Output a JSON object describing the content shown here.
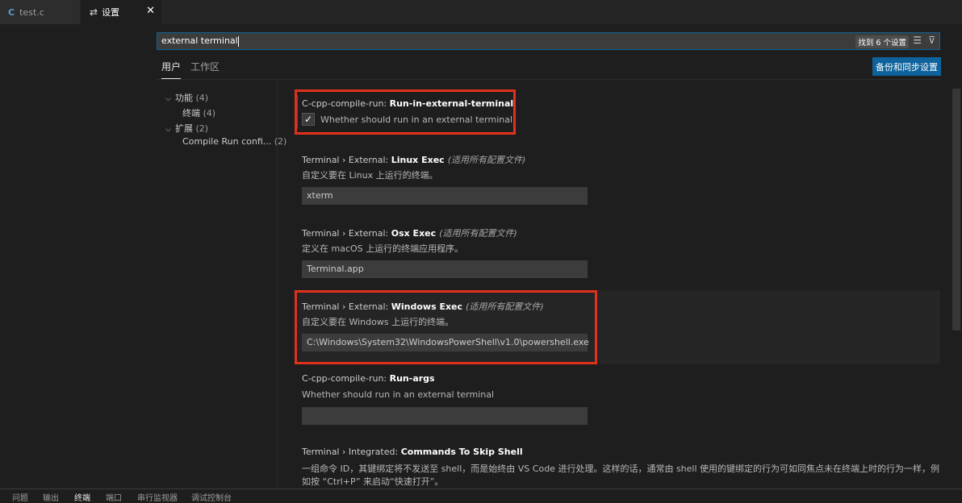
{
  "tabs": [
    {
      "icon": "C",
      "label": "test.c"
    },
    {
      "icon": "settings-icon",
      "label": "设置"
    }
  ],
  "search": {
    "value": "external terminal",
    "results_badge": "找到 6 个设置"
  },
  "scope_tabs": {
    "user": "用户",
    "workspace": "工作区"
  },
  "sync_button": "备份和同步设置",
  "toc": [
    {
      "label": "功能",
      "count": "(4)"
    },
    {
      "label": "终端",
      "count": "(4)"
    },
    {
      "label": "扩展",
      "count": "(2)"
    },
    {
      "label": "Compile Run confi...",
      "count": "(2)"
    }
  ],
  "settings": [
    {
      "prefix": "C-cpp-compile-run: ",
      "name": "Run-in-external-terminal",
      "scope": "",
      "checkbox_label": "Whether should run in an external terminal",
      "checked": true
    },
    {
      "prefix": "Terminal › External: ",
      "name": "Linux Exec",
      "scope": "(适用所有配置文件)",
      "desc": "自定义要在 Linux 上运行的终端。",
      "value": "xterm"
    },
    {
      "prefix": "Terminal › External: ",
      "name": "Osx Exec",
      "scope": "(适用所有配置文件)",
      "desc": "定义在 macOS 上运行的终端应用程序。",
      "value": "Terminal.app"
    },
    {
      "prefix": "Terminal › External: ",
      "name": "Windows Exec",
      "scope": "(适用所有配置文件)",
      "desc": "自定义要在 Windows 上运行的终端。",
      "value": "C:\\Windows\\System32\\WindowsPowerShell\\v1.0\\powershell.exe"
    },
    {
      "prefix": "C-cpp-compile-run: ",
      "name": "Run-args",
      "scope": "",
      "desc": "Whether should run in an external terminal",
      "value": ""
    },
    {
      "prefix": "Terminal › Integrated: ",
      "name": "Commands To Skip Shell",
      "scope": "",
      "desc": "一组命令 ID，其键绑定将不发送至 shell，而是始终由 VS Code 进行处理。这样的话，通常由 shell 使用的键绑定的行为可如同焦点未在终端上时的行为一样，例",
      "desc2": "如按 “Ctrl+P” 来启动“快速打开”。"
    }
  ],
  "panel_tabs": [
    "问题",
    "输出",
    "终端",
    "端口",
    "串行监视器",
    "调试控制台"
  ],
  "colors": {
    "accent": "#0e639c",
    "highlight_border": "#e0311d",
    "background": "#1e1e1e"
  }
}
